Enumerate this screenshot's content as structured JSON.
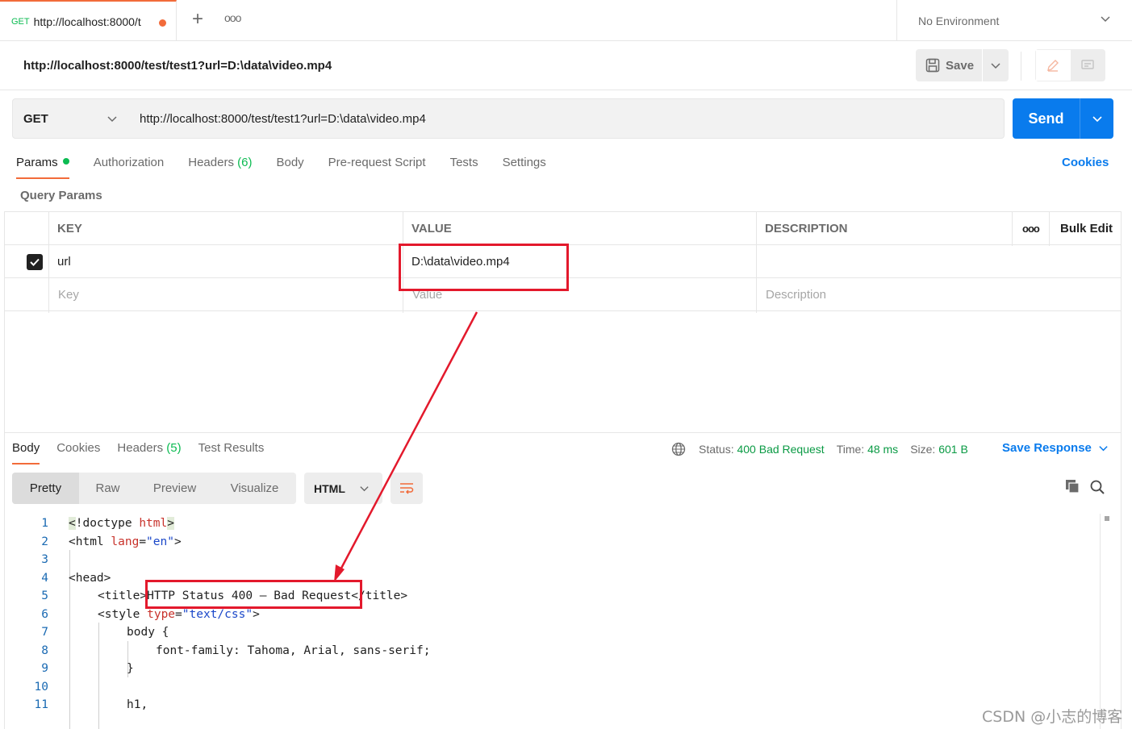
{
  "tabbar": {
    "active_tab": {
      "method": "GET",
      "url": "http://localhost:8000/t"
    },
    "new_tab_label": "+",
    "more_label": "ooo",
    "environment": "No Environment"
  },
  "header": {
    "request_title": "http://localhost:8000/test/test1?url=D:\\data\\video.mp4",
    "save_label": "Save"
  },
  "request": {
    "method": "GET",
    "url": "http://localhost:8000/test/test1?url=D:\\data\\video.mp4",
    "send_label": "Send"
  },
  "request_tabs": [
    {
      "label": "Params",
      "count": ""
    },
    {
      "label": "Authorization",
      "count": ""
    },
    {
      "label": "Headers ",
      "count": "(6)"
    },
    {
      "label": "Body",
      "count": ""
    },
    {
      "label": "Pre-request Script",
      "count": ""
    },
    {
      "label": "Tests",
      "count": ""
    },
    {
      "label": "Settings",
      "count": ""
    }
  ],
  "cookies_link": "Cookies",
  "query_params_label": "Query Params",
  "params_table": {
    "headers": {
      "key": "KEY",
      "value": "VALUE",
      "description": "DESCRIPTION",
      "more": "ooo",
      "bulk_edit": "Bulk Edit"
    },
    "rows": [
      {
        "checked": true,
        "key": "url",
        "value": "D:\\data\\video.mp4",
        "description": ""
      }
    ],
    "placeholder": {
      "key": "Key",
      "value": "Value",
      "description": "Description"
    }
  },
  "response": {
    "tabs": [
      {
        "label": "Body",
        "count": ""
      },
      {
        "label": "Cookies",
        "count": ""
      },
      {
        "label": "Headers ",
        "count": "(5)"
      },
      {
        "label": "Test Results",
        "count": ""
      }
    ],
    "status_label": "Status:",
    "status_value": "400 Bad Request",
    "time_label": "Time:",
    "time_value": "48 ms",
    "size_label": "Size:",
    "size_value": "601 B",
    "save_response_label": "Save Response",
    "view_modes": [
      "Pretty",
      "Raw",
      "Preview",
      "Visualize"
    ],
    "language": "HTML"
  },
  "code_lines": [
    {
      "n": "1",
      "text": "<!doctype html>"
    },
    {
      "n": "2",
      "text": "<html lang=\"en\">"
    },
    {
      "n": "3",
      "text": ""
    },
    {
      "n": "4",
      "text": "<head>"
    },
    {
      "n": "5",
      "text": "<title>HTTP Status 400 – Bad Request</title>"
    },
    {
      "n": "6",
      "text": "<style type=\"text/css\">"
    },
    {
      "n": "7",
      "text": "body {"
    },
    {
      "n": "8",
      "text": "font-family: Tahoma, Arial, sans-serif;"
    },
    {
      "n": "9",
      "text": "}"
    },
    {
      "n": "10",
      "text": ""
    },
    {
      "n": "11",
      "text": "h1,"
    }
  ],
  "watermark": "CSDN @小志的博客",
  "colors": {
    "accent": "#f26b3a",
    "primary": "#097bed",
    "success": "#0cbb52",
    "annotation": "#e3192c"
  }
}
